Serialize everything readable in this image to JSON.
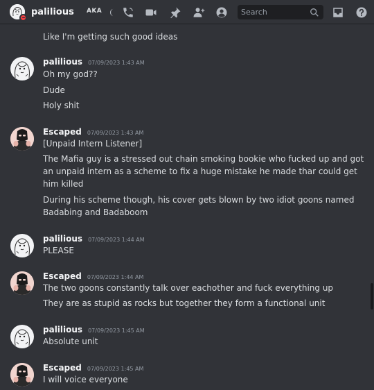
{
  "header": {
    "username": "palilious",
    "aka_label": "AKA",
    "search_placeholder": "Search",
    "icons": [
      "moon-icon",
      "call-icon",
      "video-icon",
      "pin-icon",
      "add-friend-icon",
      "user-profile-icon",
      "search-icon",
      "inbox-icon",
      "help-icon"
    ]
  },
  "messages": [
    {
      "continuation": true,
      "lines": [
        "Like I'm getting such good ideas"
      ]
    },
    {
      "author": "palilious",
      "timestamp": "07/09/2023 1:43 AM",
      "lines": [
        "Oh my god??",
        "Dude",
        "Holy shit"
      ]
    },
    {
      "author": "Escaped",
      "timestamp": "07/09/2023 1:43 AM",
      "lines": [
        "[Unpaid Intern Listener]",
        "The Mafia guy is a stressed out chain smoking bookie who fucked up and got an unpaid intern as a scheme to fix a huge mistake he made thar could get him killed",
        "During his scheme though, his cover gets blown by two idiot goons named Badabing and Badaboom"
      ]
    },
    {
      "author": "palilious",
      "timestamp": "07/09/2023 1:44 AM",
      "lines": [
        "PLEASE"
      ]
    },
    {
      "author": "Escaped",
      "timestamp": "07/09/2023 1:44 AM",
      "lines": [
        "The two goons constantly talk over eachother and fuck everything up",
        "They are as stupid as rocks but together they form a functional unit"
      ]
    },
    {
      "author": "palilious",
      "timestamp": "07/09/2023 1:45 AM",
      "lines": [
        "Absolute unit"
      ]
    },
    {
      "author": "Escaped",
      "timestamp": "07/09/2023 1:45 AM",
      "lines": [
        "I will voice everyone"
      ]
    }
  ]
}
